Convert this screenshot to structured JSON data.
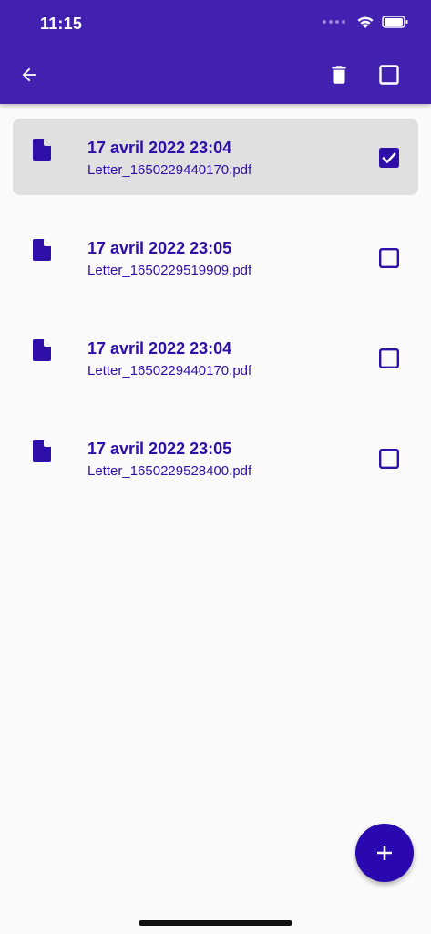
{
  "status_bar": {
    "time": "11:15"
  },
  "app_bar": {
    "back_icon": "arrow-left-icon",
    "delete_icon": "trash-icon",
    "select_all_icon": "checkbox-outline-icon"
  },
  "files": [
    {
      "date": "17 avril 2022 23:04",
      "filename": "Letter_1650229440170.pdf",
      "checked": true
    },
    {
      "date": "17 avril 2022 23:05",
      "filename": "Letter_1650229519909.pdf",
      "checked": false
    },
    {
      "date": "17 avril 2022 23:04",
      "filename": "Letter_1650229440170.pdf",
      "checked": false
    },
    {
      "date": "17 avril 2022 23:05",
      "filename": "Letter_1650229528400.pdf",
      "checked": false
    }
  ],
  "fab": {
    "icon": "plus-icon"
  },
  "colors": {
    "app_bar": "#4321b0",
    "accent": "#2e0fa8",
    "fab": "#2a08b0",
    "selected_row": "#e0e0e0",
    "background": "#fafafa"
  }
}
